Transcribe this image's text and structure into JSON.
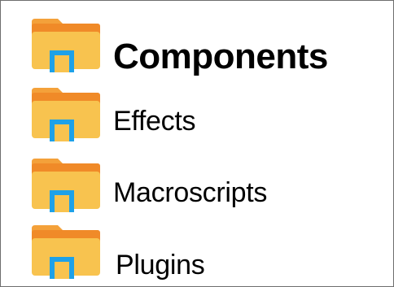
{
  "folders": [
    {
      "label": "Components",
      "icon": "folder-icon"
    },
    {
      "label": "Effects",
      "icon": "folder-icon"
    },
    {
      "label": "Macroscripts",
      "icon": "folder-icon"
    },
    {
      "label": "Plugins",
      "icon": "folder-icon"
    }
  ],
  "colors": {
    "folder_body": "#f8c34f",
    "folder_back": "#f4a13a",
    "folder_tab": "#f08a28",
    "folder_accent": "#1ea1e8",
    "text": "#000000",
    "border": "#6e6e6e"
  }
}
